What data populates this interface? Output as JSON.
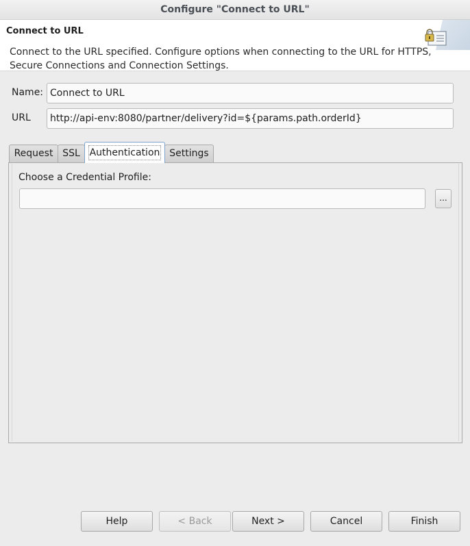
{
  "window": {
    "title": "Configure \"Connect to URL\""
  },
  "banner": {
    "title": "Connect to URL",
    "description": "Connect to the URL specified.  Configure options when connecting to the URL for HTTPS, Secure Connections and Connection Settings.",
    "icon": "lock-document-icon"
  },
  "form": {
    "name_label": "Name:",
    "name_value": "Connect to URL",
    "url_label": "URL",
    "url_value": "http://api-env:8080/partner/delivery?id=${params.path.orderId}"
  },
  "tabs": [
    {
      "label": "Request",
      "active": false
    },
    {
      "label": "SSL",
      "active": false
    },
    {
      "label": "Authentication",
      "active": true
    },
    {
      "label": "Settings",
      "active": false
    }
  ],
  "authentication": {
    "credential_label": "Choose a Credential Profile:",
    "credential_value": "",
    "browse_label": "..."
  },
  "buttons": {
    "help": "Help",
    "back": "< Back",
    "next": "Next >",
    "cancel": "Cancel",
    "finish": "Finish"
  },
  "colors": {
    "active_tab_border": "#7da2ce",
    "panel_bg": "#ececec"
  }
}
